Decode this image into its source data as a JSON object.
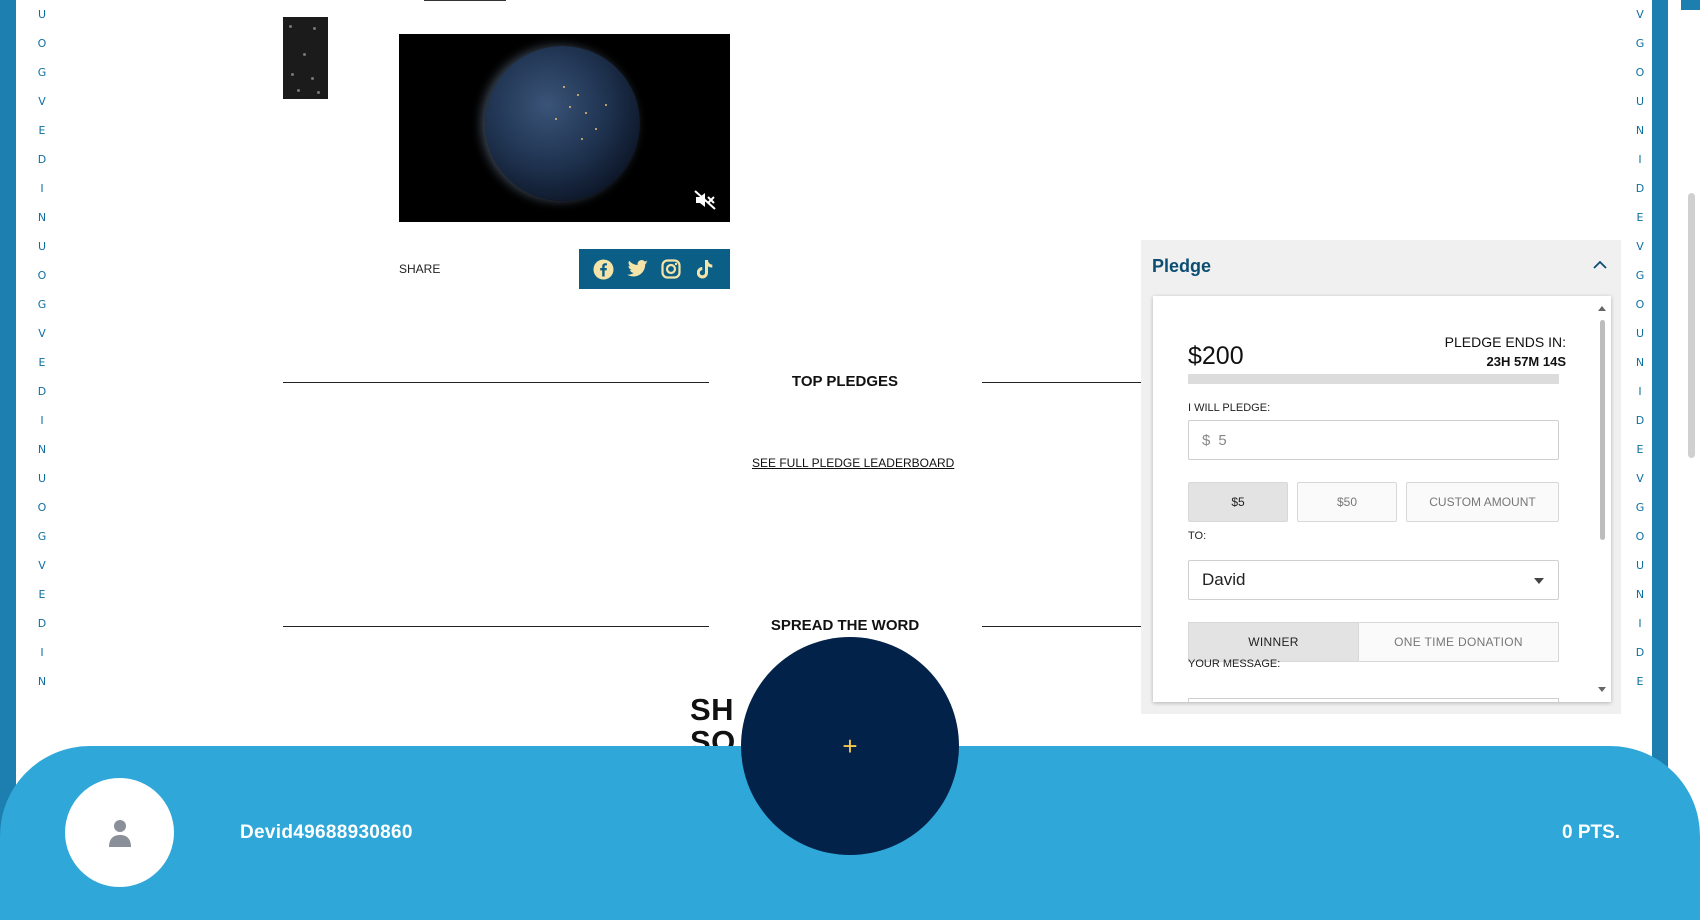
{
  "brand": {
    "vertical_text_left": [
      "U",
      "O",
      "G",
      "V",
      "E",
      "D",
      "I",
      "N",
      "U",
      "O",
      "G",
      "V",
      "E",
      "D",
      "I",
      "N",
      "U",
      "O",
      "G",
      "V",
      "E",
      "D",
      "I",
      "N"
    ],
    "vertical_text_right": [
      "V",
      "G",
      "O",
      "U",
      "N",
      "I",
      "D",
      "E",
      "V",
      "G",
      "O",
      "U",
      "N",
      "I",
      "D",
      "E",
      "V",
      "G",
      "O",
      "U",
      "N",
      "I",
      "D",
      "E"
    ],
    "accent_color": "#1d7fb0"
  },
  "media": {
    "thumbnail_icon": "thumbnail-image",
    "video_icon": "earth-video",
    "mute_icon": "muted-speaker-icon"
  },
  "share": {
    "label": "SHARE",
    "networks": [
      {
        "name": "facebook",
        "icon": "facebook-icon"
      },
      {
        "name": "twitter",
        "icon": "twitter-icon"
      },
      {
        "name": "instagram",
        "icon": "instagram-icon"
      },
      {
        "name": "tiktok",
        "icon": "tiktok-icon"
      }
    ]
  },
  "sections": {
    "top_pledges_title": "TOP PLEDGES",
    "leaderboard_link": "SEE FULL PLEDGE LEADERBOARD",
    "spread_title": "SPREAD THE WORD",
    "heading_line1": "SH          R",
    "heading_line2": "SO           LS"
  },
  "pledge": {
    "title": "Pledge",
    "amount": "$200",
    "ends_label": "PLEDGE ENDS IN:",
    "ends_value": "23H 57M 14S",
    "progress_fraction": 0.0,
    "will_pledge_label": "I WILL PLEDGE:",
    "input_currency": "$",
    "input_value": "5",
    "presets": [
      {
        "label": "$5",
        "active": true
      },
      {
        "label": "$50",
        "active": false
      },
      {
        "label": "CUSTOM AMOUNT",
        "active": false
      }
    ],
    "to_label": "TO:",
    "to_selected": "David",
    "type_options": [
      {
        "label": "WINNER",
        "active": true
      },
      {
        "label": "ONE TIME DONATION",
        "active": false
      }
    ],
    "message_label": "YOUR MESSAGE:"
  },
  "footer": {
    "username": "Devid49688930860",
    "points": "0 PTS.",
    "fab_symbol": "+",
    "avatar_icon": "user-icon"
  }
}
